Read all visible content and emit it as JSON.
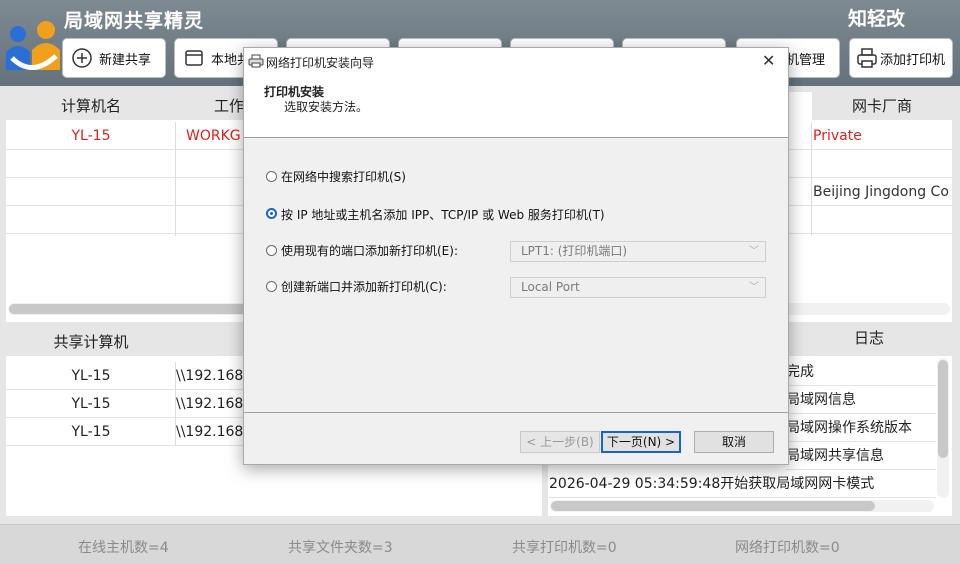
{
  "app": {
    "title": "局域网共享精灵",
    "brand": "知轻改"
  },
  "toolbar": {
    "new_share": "新建共享",
    "local_share": "本地共",
    "printer_manage": "印机管理",
    "add_printer": "添加打印机"
  },
  "top_table": {
    "headers": [
      "计算机名",
      "工作",
      "网卡厂商"
    ],
    "rows": [
      {
        "name": "YL-15",
        "workgroup": "WORKG",
        "vendor": "Private"
      },
      {
        "name": "",
        "workgroup": "",
        "vendor": ""
      },
      {
        "name": "",
        "workgroup": "",
        "vendor": "Beijing Jingdong Co"
      },
      {
        "name": "",
        "workgroup": "",
        "vendor": ""
      }
    ],
    "highlight_color": "#e02020"
  },
  "share_table": {
    "headers": [
      "共享计算机"
    ],
    "rows": [
      {
        "computer": "YL-15",
        "path": "\\\\192.168"
      },
      {
        "computer": "YL-15",
        "path": "\\\\192.168"
      },
      {
        "computer": "YL-15",
        "path": "\\\\192.168"
      }
    ]
  },
  "log": {
    "header": "日志",
    "items": [
      "完成",
      "局域网信息",
      "局域网操作系统版本",
      "局域网共享信息",
      "2026-04-29 05:34:59:48开始获取局域网网卡模式"
    ]
  },
  "status": {
    "online_hosts": "在线主机数=4",
    "shared_folders": "共享文件夹数=3",
    "shared_printers": "共享打印机数=0",
    "network_printers": "网络打印机数=0"
  },
  "dialog": {
    "title": "网络打印机安装向导",
    "heading": "打印机安装",
    "subheading": "选取安装方法。",
    "options": [
      {
        "label": "在网络中搜索打印机(S)",
        "selected": false
      },
      {
        "label": "按 IP 地址或主机名添加 IPP、TCP/IP 或 Web 服务打印机(T)",
        "selected": true
      },
      {
        "label": "使用现有的端口添加新打印机(E):",
        "selected": false
      },
      {
        "label": "创建新端口并添加新打印机(C):",
        "selected": false
      }
    ],
    "existing_port": "LPT1: (打印机端口)",
    "new_port_type": "Local Port",
    "back": "< 上一步(B)",
    "next": "下一页(N) >",
    "cancel": "取消",
    "accent": "#1a63c7"
  }
}
